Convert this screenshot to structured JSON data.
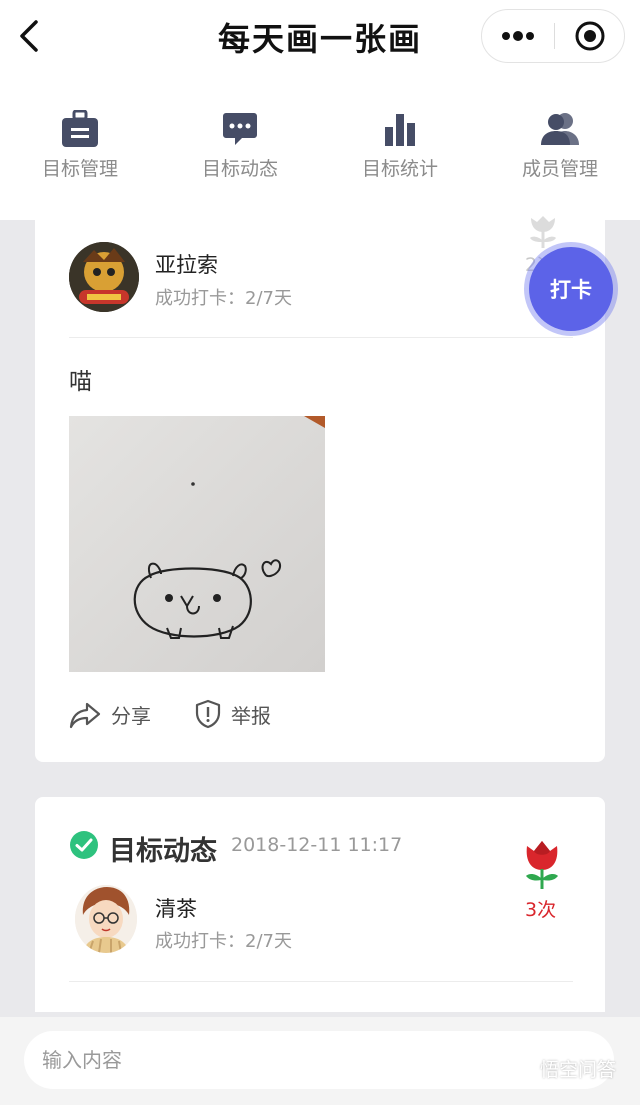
{
  "header": {
    "title": "每天画一张画",
    "back_icon": "chevron-left-icon",
    "more_icon": "more-dots-icon",
    "close_icon": "target-close-icon"
  },
  "tabs": [
    {
      "label": "目标管理",
      "icon": "briefcase-icon"
    },
    {
      "label": "目标动态",
      "icon": "chat-bubble-icon"
    },
    {
      "label": "目标统计",
      "icon": "bar-chart-icon"
    },
    {
      "label": "成员管理",
      "icon": "members-icon"
    }
  ],
  "post1": {
    "user": "亚拉索",
    "status": "成功打卡：2/7天",
    "rose_count": "2次",
    "text": "喵",
    "actions": {
      "share": "分享",
      "report": "举报"
    }
  },
  "fab_label": "打卡",
  "post2": {
    "title": "目标动态",
    "time": "2018-12-11 11:17",
    "user": "清茶",
    "status": "成功打卡：2/7天",
    "rose_count": "3次"
  },
  "footer": {
    "placeholder": "输入内容",
    "watermark": "悟空问答"
  },
  "colors": {
    "accent": "#5c63e8",
    "icon_dark": "#464d66",
    "check_green": "#2ec27e",
    "rose_red": "#d9262c"
  }
}
